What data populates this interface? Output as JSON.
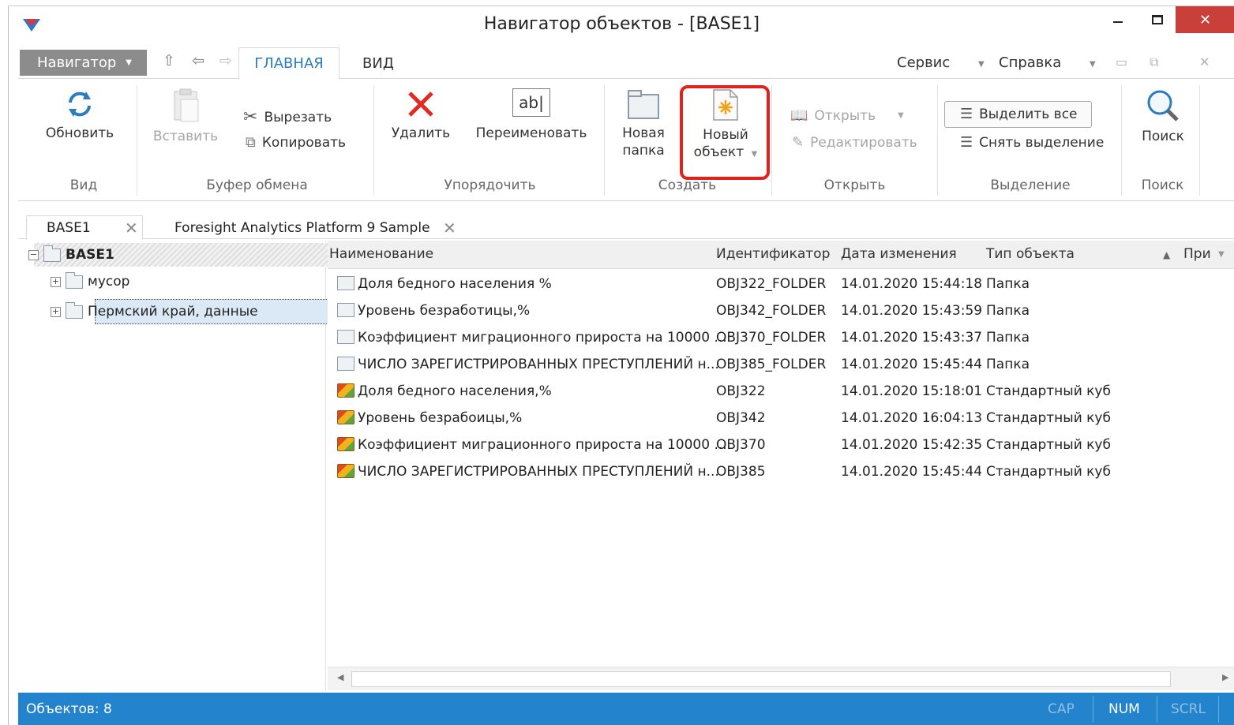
{
  "window": {
    "title": "Навигатор объектов - [BASE1]",
    "close_glyph": "✕"
  },
  "ribbon_tabs": {
    "navigator_label": "Навигатор",
    "home_tab": "ГЛАВНАЯ",
    "view_tab": "ВИД",
    "service_menu": "Сервис",
    "help_menu": "Справка"
  },
  "ribbon": {
    "refresh": "Обновить",
    "paste": "Вставить",
    "cut": "Вырезать",
    "copy": "Копировать",
    "delete": "Удалить",
    "rename": "Переименовать",
    "rename_glyph": "ab|",
    "new_folder_line1": "Новая",
    "new_folder_line2": "папка",
    "new_object_line1": "Новый",
    "new_object_line2": "объект",
    "open": "Открыть",
    "edit": "Редактировать",
    "select_all": "Выделить все",
    "deselect": "Снять выделение",
    "search": "Поиск",
    "groups": {
      "view": "Вид",
      "clipboard": "Буфер обмена",
      "organize": "Упорядочить",
      "create": "Создать",
      "open": "Открыть",
      "selection": "Выделение",
      "search": "Поиск"
    }
  },
  "doc_tabs": [
    "BASE1",
    "Foresight Analytics Platform 9 Sample"
  ],
  "tree": {
    "root": "BASE1",
    "children": [
      "мусор",
      "Пермский край, данные"
    ],
    "expander_collapsed": "+",
    "expander_expanded": "−"
  },
  "list": {
    "columns": [
      "Наименование",
      "Идентификатор",
      "Дата изменения",
      "Тип объекта",
      "При"
    ],
    "rows": [
      {
        "name": "Доля бедного населения %",
        "id": "OBJ322_FOLDER",
        "date": "14.01.2020 15:44:18",
        "type": "Папка",
        "icon": "folder-icon"
      },
      {
        "name": "Уровень безработицы,%",
        "id": "OBJ342_FOLDER",
        "date": "14.01.2020 15:43:59",
        "type": "Папка",
        "icon": "folder-icon"
      },
      {
        "name": "Коэффициент миграционного прироста на 10000 ...",
        "id": "OBJ370_FOLDER",
        "date": "14.01.2020 15:43:37",
        "type": "Папка",
        "icon": "folder-icon"
      },
      {
        "name": "ЧИСЛО ЗАРЕГИСТРИРОВАННЫХ ПРЕСТУПЛЕНИЙ н...",
        "id": "OBJ385_FOLDER",
        "date": "14.01.2020 15:45:44",
        "type": "Папка",
        "icon": "folder-icon"
      },
      {
        "name": "Доля бедного населения,%",
        "id": "OBJ322",
        "date": "14.01.2020 15:18:01",
        "type": "Стандартный куб",
        "icon": "cube-icon"
      },
      {
        "name": "Уровень безрабоицы,%",
        "id": "OBJ342",
        "date": "14.01.2020 16:04:13",
        "type": "Стандартный куб",
        "icon": "cube-icon"
      },
      {
        "name": "Коэффициент миграционного прироста на 10000 ...",
        "id": "OBJ370",
        "date": "14.01.2020 15:42:35",
        "type": "Стандартный куб",
        "icon": "cube-icon"
      },
      {
        "name": "ЧИСЛО ЗАРЕГИСТРИРОВАННЫХ ПРЕСТУПЛЕНИЙ н...",
        "id": "OBJ385",
        "date": "14.01.2020 15:45:44",
        "type": "Стандартный куб",
        "icon": "cube-icon"
      }
    ]
  },
  "status": {
    "count": "Объектов: 8",
    "cap": "CAP",
    "num": "NUM",
    "scrl": "SCRL"
  },
  "colors": {
    "accent": "#2383cc",
    "highlight": "#e3211b",
    "close": "#c9403a"
  }
}
